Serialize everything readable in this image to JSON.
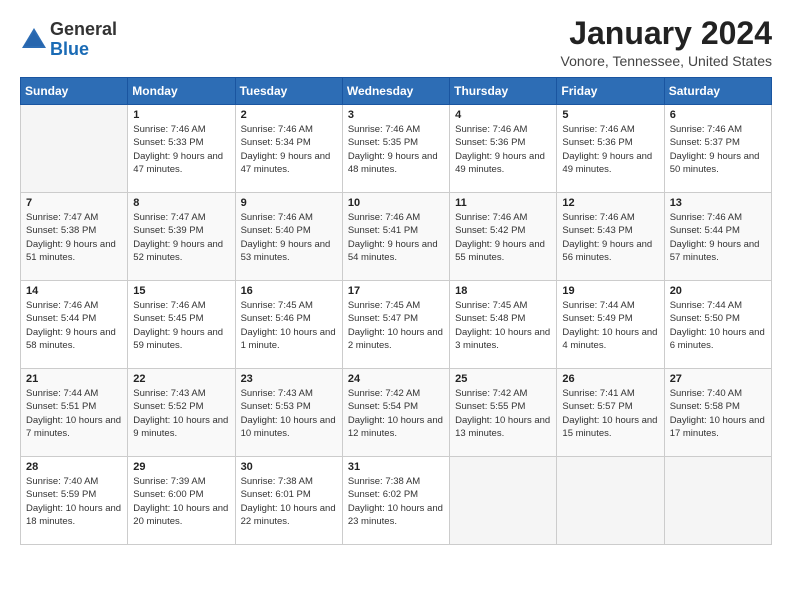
{
  "logo": {
    "general": "General",
    "blue": "Blue"
  },
  "header": {
    "month_year": "January 2024",
    "location": "Vonore, Tennessee, United States"
  },
  "days_of_week": [
    "Sunday",
    "Monday",
    "Tuesday",
    "Wednesday",
    "Thursday",
    "Friday",
    "Saturday"
  ],
  "weeks": [
    [
      {
        "day": "",
        "sunrise": "",
        "sunset": "",
        "daylight": ""
      },
      {
        "day": "1",
        "sunrise": "Sunrise: 7:46 AM",
        "sunset": "Sunset: 5:33 PM",
        "daylight": "Daylight: 9 hours and 47 minutes."
      },
      {
        "day": "2",
        "sunrise": "Sunrise: 7:46 AM",
        "sunset": "Sunset: 5:34 PM",
        "daylight": "Daylight: 9 hours and 47 minutes."
      },
      {
        "day": "3",
        "sunrise": "Sunrise: 7:46 AM",
        "sunset": "Sunset: 5:35 PM",
        "daylight": "Daylight: 9 hours and 48 minutes."
      },
      {
        "day": "4",
        "sunrise": "Sunrise: 7:46 AM",
        "sunset": "Sunset: 5:36 PM",
        "daylight": "Daylight: 9 hours and 49 minutes."
      },
      {
        "day": "5",
        "sunrise": "Sunrise: 7:46 AM",
        "sunset": "Sunset: 5:36 PM",
        "daylight": "Daylight: 9 hours and 49 minutes."
      },
      {
        "day": "6",
        "sunrise": "Sunrise: 7:46 AM",
        "sunset": "Sunset: 5:37 PM",
        "daylight": "Daylight: 9 hours and 50 minutes."
      }
    ],
    [
      {
        "day": "7",
        "sunrise": "Sunrise: 7:47 AM",
        "sunset": "Sunset: 5:38 PM",
        "daylight": "Daylight: 9 hours and 51 minutes."
      },
      {
        "day": "8",
        "sunrise": "Sunrise: 7:47 AM",
        "sunset": "Sunset: 5:39 PM",
        "daylight": "Daylight: 9 hours and 52 minutes."
      },
      {
        "day": "9",
        "sunrise": "Sunrise: 7:46 AM",
        "sunset": "Sunset: 5:40 PM",
        "daylight": "Daylight: 9 hours and 53 minutes."
      },
      {
        "day": "10",
        "sunrise": "Sunrise: 7:46 AM",
        "sunset": "Sunset: 5:41 PM",
        "daylight": "Daylight: 9 hours and 54 minutes."
      },
      {
        "day": "11",
        "sunrise": "Sunrise: 7:46 AM",
        "sunset": "Sunset: 5:42 PM",
        "daylight": "Daylight: 9 hours and 55 minutes."
      },
      {
        "day": "12",
        "sunrise": "Sunrise: 7:46 AM",
        "sunset": "Sunset: 5:43 PM",
        "daylight": "Daylight: 9 hours and 56 minutes."
      },
      {
        "day": "13",
        "sunrise": "Sunrise: 7:46 AM",
        "sunset": "Sunset: 5:44 PM",
        "daylight": "Daylight: 9 hours and 57 minutes."
      }
    ],
    [
      {
        "day": "14",
        "sunrise": "Sunrise: 7:46 AM",
        "sunset": "Sunset: 5:44 PM",
        "daylight": "Daylight: 9 hours and 58 minutes."
      },
      {
        "day": "15",
        "sunrise": "Sunrise: 7:46 AM",
        "sunset": "Sunset: 5:45 PM",
        "daylight": "Daylight: 9 hours and 59 minutes."
      },
      {
        "day": "16",
        "sunrise": "Sunrise: 7:45 AM",
        "sunset": "Sunset: 5:46 PM",
        "daylight": "Daylight: 10 hours and 1 minute."
      },
      {
        "day": "17",
        "sunrise": "Sunrise: 7:45 AM",
        "sunset": "Sunset: 5:47 PM",
        "daylight": "Daylight: 10 hours and 2 minutes."
      },
      {
        "day": "18",
        "sunrise": "Sunrise: 7:45 AM",
        "sunset": "Sunset: 5:48 PM",
        "daylight": "Daylight: 10 hours and 3 minutes."
      },
      {
        "day": "19",
        "sunrise": "Sunrise: 7:44 AM",
        "sunset": "Sunset: 5:49 PM",
        "daylight": "Daylight: 10 hours and 4 minutes."
      },
      {
        "day": "20",
        "sunrise": "Sunrise: 7:44 AM",
        "sunset": "Sunset: 5:50 PM",
        "daylight": "Daylight: 10 hours and 6 minutes."
      }
    ],
    [
      {
        "day": "21",
        "sunrise": "Sunrise: 7:44 AM",
        "sunset": "Sunset: 5:51 PM",
        "daylight": "Daylight: 10 hours and 7 minutes."
      },
      {
        "day": "22",
        "sunrise": "Sunrise: 7:43 AM",
        "sunset": "Sunset: 5:52 PM",
        "daylight": "Daylight: 10 hours and 9 minutes."
      },
      {
        "day": "23",
        "sunrise": "Sunrise: 7:43 AM",
        "sunset": "Sunset: 5:53 PM",
        "daylight": "Daylight: 10 hours and 10 minutes."
      },
      {
        "day": "24",
        "sunrise": "Sunrise: 7:42 AM",
        "sunset": "Sunset: 5:54 PM",
        "daylight": "Daylight: 10 hours and 12 minutes."
      },
      {
        "day": "25",
        "sunrise": "Sunrise: 7:42 AM",
        "sunset": "Sunset: 5:55 PM",
        "daylight": "Daylight: 10 hours and 13 minutes."
      },
      {
        "day": "26",
        "sunrise": "Sunrise: 7:41 AM",
        "sunset": "Sunset: 5:57 PM",
        "daylight": "Daylight: 10 hours and 15 minutes."
      },
      {
        "day": "27",
        "sunrise": "Sunrise: 7:40 AM",
        "sunset": "Sunset: 5:58 PM",
        "daylight": "Daylight: 10 hours and 17 minutes."
      }
    ],
    [
      {
        "day": "28",
        "sunrise": "Sunrise: 7:40 AM",
        "sunset": "Sunset: 5:59 PM",
        "daylight": "Daylight: 10 hours and 18 minutes."
      },
      {
        "day": "29",
        "sunrise": "Sunrise: 7:39 AM",
        "sunset": "Sunset: 6:00 PM",
        "daylight": "Daylight: 10 hours and 20 minutes."
      },
      {
        "day": "30",
        "sunrise": "Sunrise: 7:38 AM",
        "sunset": "Sunset: 6:01 PM",
        "daylight": "Daylight: 10 hours and 22 minutes."
      },
      {
        "day": "31",
        "sunrise": "Sunrise: 7:38 AM",
        "sunset": "Sunset: 6:02 PM",
        "daylight": "Daylight: 10 hours and 23 minutes."
      },
      {
        "day": "",
        "sunrise": "",
        "sunset": "",
        "daylight": ""
      },
      {
        "day": "",
        "sunrise": "",
        "sunset": "",
        "daylight": ""
      },
      {
        "day": "",
        "sunrise": "",
        "sunset": "",
        "daylight": ""
      }
    ]
  ]
}
